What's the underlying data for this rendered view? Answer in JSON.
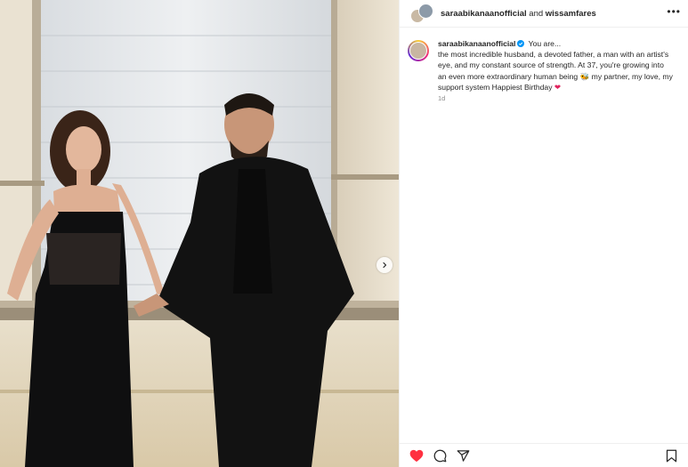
{
  "post": {
    "header": {
      "author_primary": "saraabikanaanofficial",
      "connector": "and",
      "author_secondary": "wissamfares",
      "more_label": "•••"
    },
    "caption": {
      "username": "saraabikanaanofficial",
      "verified": true,
      "text_line1": "You are...",
      "text_body": "the most incredible husband, a devoted father, a man with an artist's eye, and my constant source of strength. At 37, you're growing into an even more extraordinary human being",
      "text_tail": "my partner, my love, my support system Happiest Birthday",
      "emoji_bee": "🐝",
      "emoji_heart": "❤",
      "timestamp": "1d"
    },
    "actions": {
      "liked": true,
      "like_icon": "heart-filled-icon",
      "comment_icon": "comment-icon",
      "share_icon": "share-icon",
      "save_icon": "bookmark-icon"
    },
    "media": {
      "description_alt": "photo",
      "has_next": true
    }
  },
  "colors": {
    "like_red": "#ff3040",
    "verified_blue": "#0095f6",
    "muted_text": "#8e8e8e"
  }
}
